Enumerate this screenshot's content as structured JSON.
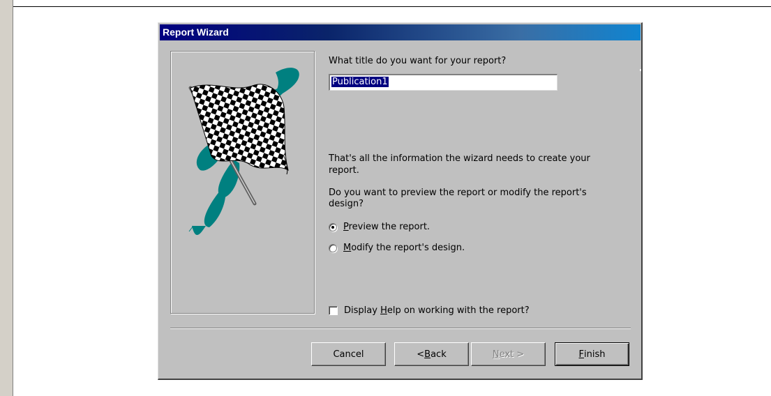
{
  "dialog": {
    "title": "Report Wizard",
    "title_prompt": "What title do you want for your report?",
    "title_value": "Publication1",
    "info_text_1": "That's all the information the wizard needs to create your",
    "info_text_2": "report.",
    "question_1": "Do you want to preview the report or modify the report's",
    "question_2": "design?",
    "options": [
      {
        "pre": "",
        "accel": "P",
        "post": "review the report.",
        "checked": true
      },
      {
        "pre": "",
        "accel": "M",
        "post": "odify the report's design.",
        "checked": false
      }
    ],
    "help_checkbox": {
      "pre": "Display ",
      "accel": "H",
      "post": "elp on working with the report?",
      "checked": false
    },
    "buttons": {
      "cancel": {
        "label": "Cancel"
      },
      "back": {
        "pre": "< ",
        "accel": "B",
        "post": "ack"
      },
      "next": {
        "pre": "",
        "accel": "N",
        "post": "ext >",
        "disabled": true
      },
      "finish": {
        "pre": "",
        "accel": "F",
        "post": "inish"
      }
    },
    "image_icon": "checkered-flag-icon"
  },
  "colors": {
    "dialog_face": "#c0c0c0",
    "title_bar_start": "#000080",
    "title_bar_end": "#1084d0",
    "flag_accent": "#008080"
  }
}
